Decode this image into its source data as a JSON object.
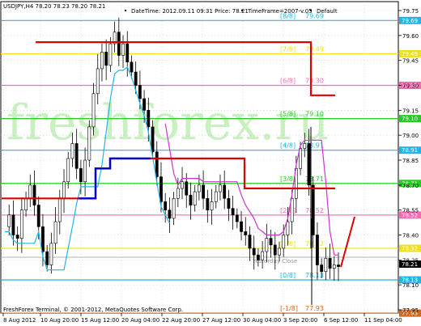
{
  "header": {
    "symbol_info": "USDJPY,H4  78.20 78.23 78.20 78.21",
    "datetime_info": "DateTime: 2012.09.11 09:31   Price: 78.21",
    "timeframe_info": "TimeFrame=2007-v.05",
    "default_label": "Default"
  },
  "watermark": "freshforex.ru",
  "footer": "FreshForex Terminal, © 2001-2012, MetaQuotes Software Corp.",
  "yesterday_close_label": "Yesterday Close",
  "price_axis": {
    "ticks": [
      "79.75",
      "79.60",
      "79.45",
      "79.30",
      "79.15",
      "79.00",
      "78.85",
      "78.70",
      "78.55",
      "78.40",
      "78.25",
      "78.10",
      "77.95"
    ]
  },
  "time_axis": {
    "ticks": [
      "8 Aug 2012",
      "10 Aug 20:00",
      "15 Aug 12:00",
      "20 Aug 04:00",
      "22 Aug 20:00",
      "27 Aug 12:00",
      "30 Aug 04:00",
      "3 Sep 20:00",
      "6 Sep 12:00",
      "11 Sep 04:00"
    ]
  },
  "murrey_levels": [
    {
      "name": "[8/8]",
      "value": "79.69",
      "color": "#22b5e6",
      "badge": "79.69"
    },
    {
      "name": "[7/8]",
      "value": "79.49",
      "color": "#f0e020",
      "badge": "79.49"
    },
    {
      "name": "[6/8]",
      "value": "79.30",
      "color": "#ff69b4",
      "badge": "79.30"
    },
    {
      "name": "[5/8]",
      "value": "79.10",
      "color": "#22cc22",
      "badge": "79.10"
    },
    {
      "name": "[4/8]",
      "value": "78.91",
      "color": "#22b5e6",
      "badge": "78.91"
    },
    {
      "name": "[3/8]",
      "value": "78.71",
      "color": "#22cc22",
      "badge": "78.71"
    },
    {
      "name": "[2/8]",
      "value": "78.52",
      "color": "#ff69b4",
      "badge": "78.52"
    },
    {
      "name": "[1/8]",
      "value": "78.32",
      "color": "#f0e020",
      "badge": "78.32"
    },
    {
      "name": "[0/8]",
      "value": "78.13",
      "color": "#22b5e6",
      "badge": "78.13"
    },
    {
      "name": "[-1/8]",
      "value": "77.93",
      "color": "#d2691e",
      "badge": "77.93"
    }
  ],
  "current_price_badge": "78.21",
  "current_price_badge_color": "#000000",
  "colors": {
    "grid": "#c0c0c0",
    "candle": "#000000",
    "red_line": "#dd0000",
    "blue_line": "#0000cc",
    "cyan_line": "#22b5e6",
    "magenta_line": "#cc33cc",
    "yesterday_close_line": "#b0b0b0"
  }
}
